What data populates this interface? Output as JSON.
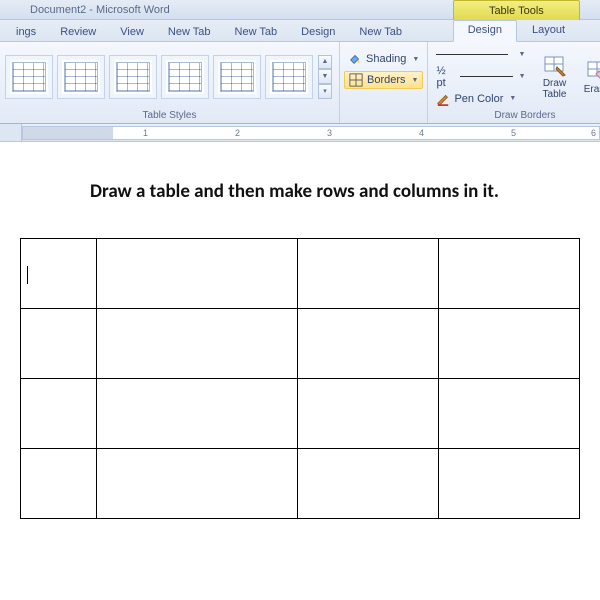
{
  "title": "Document2  -  Microsoft Word",
  "tabs": [
    "ings",
    "Review",
    "View",
    "New Tab",
    "New Tab",
    "Design",
    "New Tab"
  ],
  "tableTools": {
    "header": "Table Tools",
    "tabs": [
      "Design",
      "Layout"
    ],
    "activeIndex": 0
  },
  "ribbon": {
    "groups": {
      "tableStyles": {
        "label": "Table Styles"
      },
      "sb": {
        "shading": "Shading",
        "borders": "Borders"
      },
      "drawBorders": {
        "label": "Draw Borders",
        "lineWidth": "½ pt",
        "penColor": "Pen Color",
        "drawTable": "Draw Table",
        "eraser": "Eraser"
      }
    }
  },
  "ruler": {
    "marks": [
      1,
      2,
      3,
      4,
      5,
      6
    ]
  },
  "document": {
    "text": "Draw a table and then make rows and columns in it.",
    "table": {
      "rows": 4,
      "cols": 4
    }
  }
}
